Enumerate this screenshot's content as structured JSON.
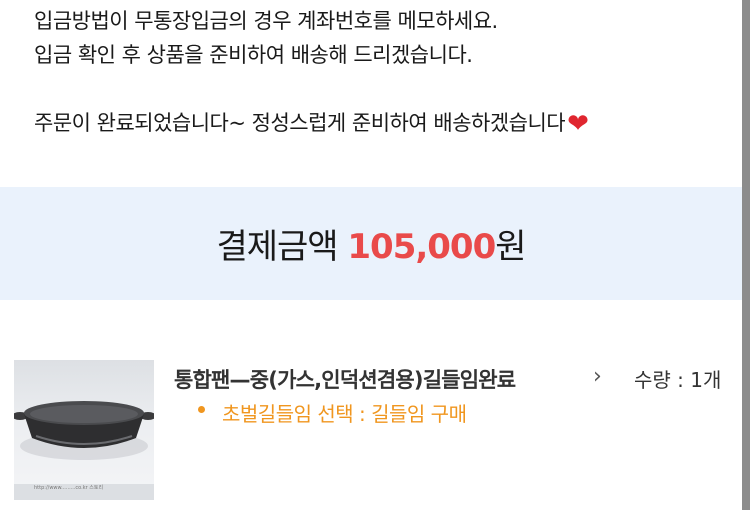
{
  "notice": {
    "line1": "입금방법이 무통장입금의 경우 계좌번호를 메모하세요.",
    "line2": "입금 확인 후 상품을 준비하여 배송해 드리겠습니다.",
    "line3": "주문이 완료되었습니다~ 정성스럽게 준비하여 배송하겠습니다",
    "heart": "❤"
  },
  "payment": {
    "label": "결제금액",
    "amount": "105,000",
    "unit": "원"
  },
  "product": {
    "name": "통합팬—중(가스,인덕션겸용)길들임완료",
    "chevron": "›",
    "quantity": "수량 : 1개",
    "option": "초벌길들임 선택 : 길들임 구매",
    "image_watermark": "http://www.........co.kr   스토리"
  },
  "colors": {
    "accent_red": "#e94a4a",
    "option_orange": "#f0961f",
    "band_bg": "#eaf2fc"
  }
}
